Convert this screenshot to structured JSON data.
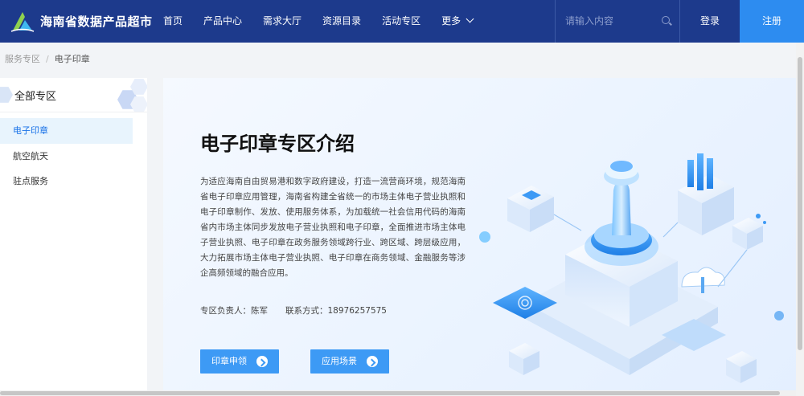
{
  "header": {
    "site_title": "海南省数据产品超市",
    "nav": [
      "首页",
      "产品中心",
      "需求大厅",
      "资源目录",
      "活动专区",
      "更多"
    ],
    "search_placeholder": "请输入内容",
    "login_label": "登录",
    "register_label": "注册",
    "bg_color": "#1d3a8c",
    "accent_color": "#2d8cf0"
  },
  "breadcrumb": {
    "parent": "服务专区",
    "separator": "/",
    "current": "电子印章"
  },
  "sidebar": {
    "title": "全部专区",
    "items": [
      {
        "label": "电子印章",
        "active": true
      },
      {
        "label": "航空航天",
        "active": false
      },
      {
        "label": "驻点服务",
        "active": false
      }
    ]
  },
  "main": {
    "title": "电子印章专区介绍",
    "description": "为适应海南自由贸易港和数字政府建设，打造一流营商环境，规范海南省电子印章应用管理，海南省构建全省统一的市场主体电子营业执照和电子印章制作、发放、使用服务体系，为加载统一社会信用代码的海南省内市场主体同步发放电子营业执照和电子印章，全面推进市场主体电子营业执照、电子印章在政务服务领域跨行业、跨区域、跨层级应用，大力拓展市场主体电子营业执照、电子印章在商务领域、金融服务等涉企高频领域的融合应用。",
    "contact": {
      "owner_label": "专区负责人：",
      "owner": "陈军",
      "phone_label": "联系方式：",
      "phone": "18976257575"
    },
    "buttons": {
      "apply": "印章申领",
      "scenes": "应用场景"
    }
  }
}
